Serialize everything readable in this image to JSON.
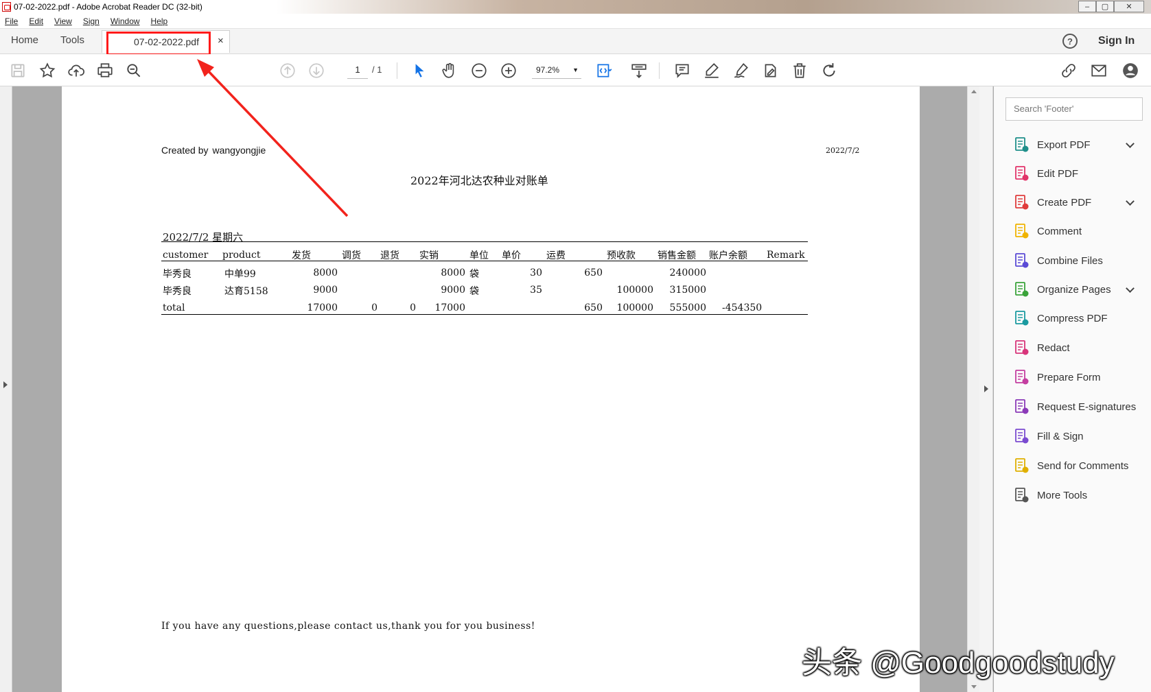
{
  "window": {
    "title": "07-02-2022.pdf - Adobe Acrobat Reader DC (32-bit)",
    "controls": [
      "–",
      "▢",
      "✕"
    ]
  },
  "menu": [
    "File",
    "Edit",
    "View",
    "Sign",
    "Window",
    "Help"
  ],
  "tabs": {
    "home": "Home",
    "tools": "Tools",
    "document": "07-02-2022.pdf",
    "close": "×",
    "sign_in": "Sign In",
    "help": "?"
  },
  "toolbar": {
    "page_current": "1",
    "page_total": "/ 1",
    "zoom": "97.2%",
    "icons": [
      "save-icon",
      "bookmark-star-icon",
      "upload-cloud-icon",
      "print-icon",
      "zoom-search-icon",
      "page-up-icon",
      "page-down-icon",
      "select-cursor-icon",
      "hand-pan-icon",
      "zoom-out-icon",
      "zoom-in-icon",
      "fit-page-icon",
      "scroll-mode-icon",
      "comment-icon",
      "highlight-icon",
      "sign-icon",
      "edit-text-icon",
      "delete-icon",
      "rotate-icon",
      "share-link-icon",
      "email-icon",
      "account-icon"
    ]
  },
  "document": {
    "created_by_label": "Created by",
    "created_by_name": "wangyongjie",
    "header_date": "2022/7/2",
    "title": "2022年河北达农种业对账单",
    "subheader": "2022/7/2  星期六",
    "columns": [
      "customer",
      "product",
      "发货",
      "调货",
      "退货",
      "实销",
      "单位",
      "单价",
      "运费",
      "预收款",
      "销售金额",
      "账户余额",
      "Remark"
    ],
    "rows": [
      {
        "customer": "毕秀良",
        "product": "中单99",
        "shipped": "8000",
        "transfer": "",
        "returned": "",
        "actual": "8000",
        "unit": "袋",
        "price": "30",
        "freight": "650",
        "prepaid": "",
        "sales": "240000",
        "balance": "",
        "remark": ""
      },
      {
        "customer": "毕秀良",
        "product": "达育5158",
        "shipped": "9000",
        "transfer": "",
        "returned": "",
        "actual": "9000",
        "unit": "袋",
        "price": "35",
        "freight": "",
        "prepaid": "100000",
        "sales": "315000",
        "balance": "",
        "remark": ""
      }
    ],
    "total": {
      "label": "total",
      "shipped": "17000",
      "transfer": "0",
      "returned": "0",
      "actual": "17000",
      "freight": "650",
      "prepaid": "100000",
      "sales": "555000",
      "balance": "-454350"
    },
    "footer_note": "If you have any questions,please contact us,thank you for you business!"
  },
  "right_panel": {
    "search_placeholder": "Search 'Footer'",
    "tools": [
      {
        "label": "Export PDF",
        "icon": "export-pdf-icon",
        "color": "#1f8f8a",
        "expandable": true
      },
      {
        "label": "Edit PDF",
        "icon": "edit-pdf-icon",
        "color": "#e2346a",
        "expandable": false
      },
      {
        "label": "Create PDF",
        "icon": "create-pdf-icon",
        "color": "#e03c3c",
        "expandable": true
      },
      {
        "label": "Comment",
        "icon": "comment-tool-icon",
        "color": "#f0b400",
        "expandable": false
      },
      {
        "label": "Combine Files",
        "icon": "combine-files-icon",
        "color": "#5b4bd6",
        "expandable": false
      },
      {
        "label": "Organize Pages",
        "icon": "organize-pages-icon",
        "color": "#3aa33a",
        "expandable": true
      },
      {
        "label": "Compress PDF",
        "icon": "compress-pdf-icon",
        "color": "#1a9aa0",
        "expandable": false
      },
      {
        "label": "Redact",
        "icon": "redact-icon",
        "color": "#d8357a",
        "expandable": false
      },
      {
        "label": "Prepare Form",
        "icon": "prepare-form-icon",
        "color": "#c43ea0",
        "expandable": false
      },
      {
        "label": "Request E-signatures",
        "icon": "request-esign-icon",
        "color": "#8b3ab8",
        "expandable": false
      },
      {
        "label": "Fill & Sign",
        "icon": "fill-sign-icon",
        "color": "#7a4bd0",
        "expandable": false
      },
      {
        "label": "Send for Comments",
        "icon": "send-comments-icon",
        "color": "#e0b000",
        "expandable": false
      },
      {
        "label": "More Tools",
        "icon": "more-tools-icon",
        "color": "#555555",
        "expandable": false
      }
    ]
  },
  "watermark": "头条 @Goodgoodstudy",
  "colors": {
    "highlight_red": "#ff1a1a",
    "accent_blue": "#1473e6"
  }
}
